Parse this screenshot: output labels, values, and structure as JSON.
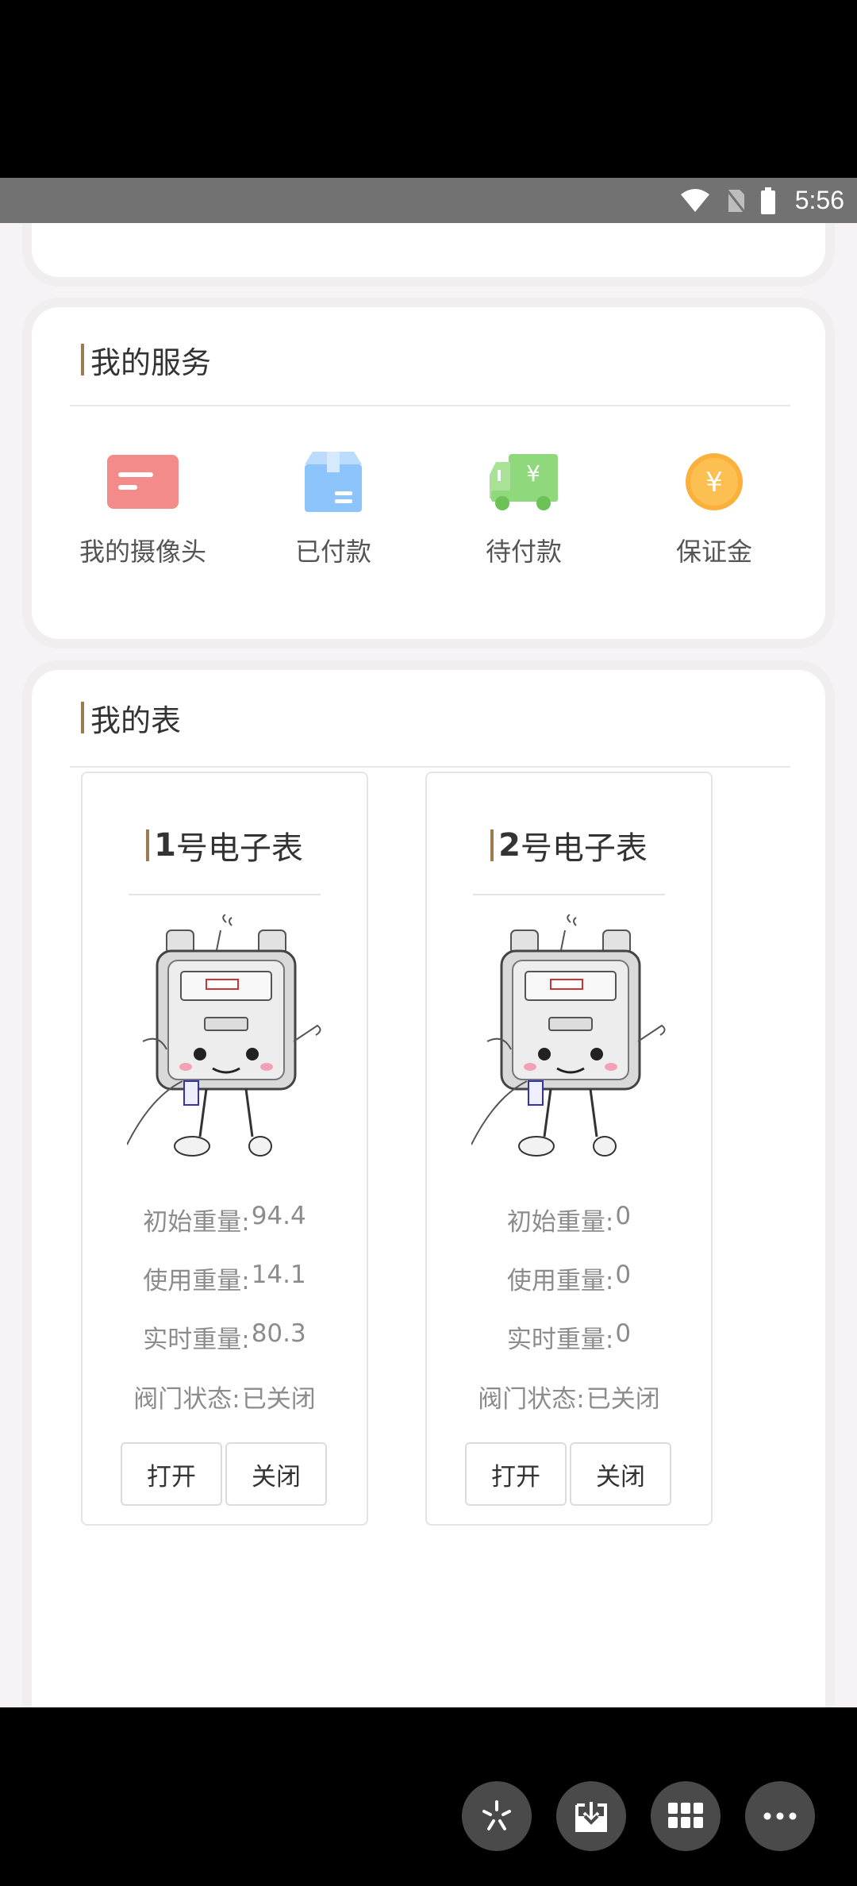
{
  "status_bar": {
    "time": "5:56"
  },
  "services": {
    "title": "我的服务",
    "items": [
      {
        "label": "我的摄像头",
        "icon": "card-icon",
        "color": "#f38b8b"
      },
      {
        "label": "已付款",
        "icon": "box-icon",
        "color": "#8cc4fb"
      },
      {
        "label": "待付款",
        "icon": "truck-yuan-icon",
        "color": "#8fd87c"
      },
      {
        "label": "保证金",
        "icon": "yuan-coin-icon",
        "color": "#fbb03b"
      }
    ]
  },
  "meters": {
    "title": "我的表",
    "items": [
      {
        "number": "1",
        "name": "号电子表",
        "initial_label": "初始重量:",
        "initial_value": "94.4",
        "used_label": "使用重量:",
        "used_value": "14.1",
        "realtime_label": "实时重量:",
        "realtime_value": "80.3",
        "valve_label": "阀门状态:",
        "valve_value": "已关闭",
        "open_label": "打开",
        "close_label": "关闭"
      },
      {
        "number": "2",
        "name": "号电子表",
        "initial_label": "初始重量:",
        "initial_value": "0",
        "used_label": "使用重量:",
        "used_value": "0",
        "realtime_label": "实时重量:",
        "realtime_value": "0",
        "valve_label": "阀门状态:",
        "valve_value": "已关闭",
        "open_label": "打开",
        "close_label": "关闭"
      }
    ]
  },
  "floating_buttons": [
    {
      "icon": "sparkle-icon"
    },
    {
      "icon": "download-icon"
    },
    {
      "icon": "grid-icon"
    },
    {
      "icon": "more-icon"
    }
  ],
  "colors": {
    "accent_bar": "#9e7a52",
    "background": "#f7f2f5"
  }
}
